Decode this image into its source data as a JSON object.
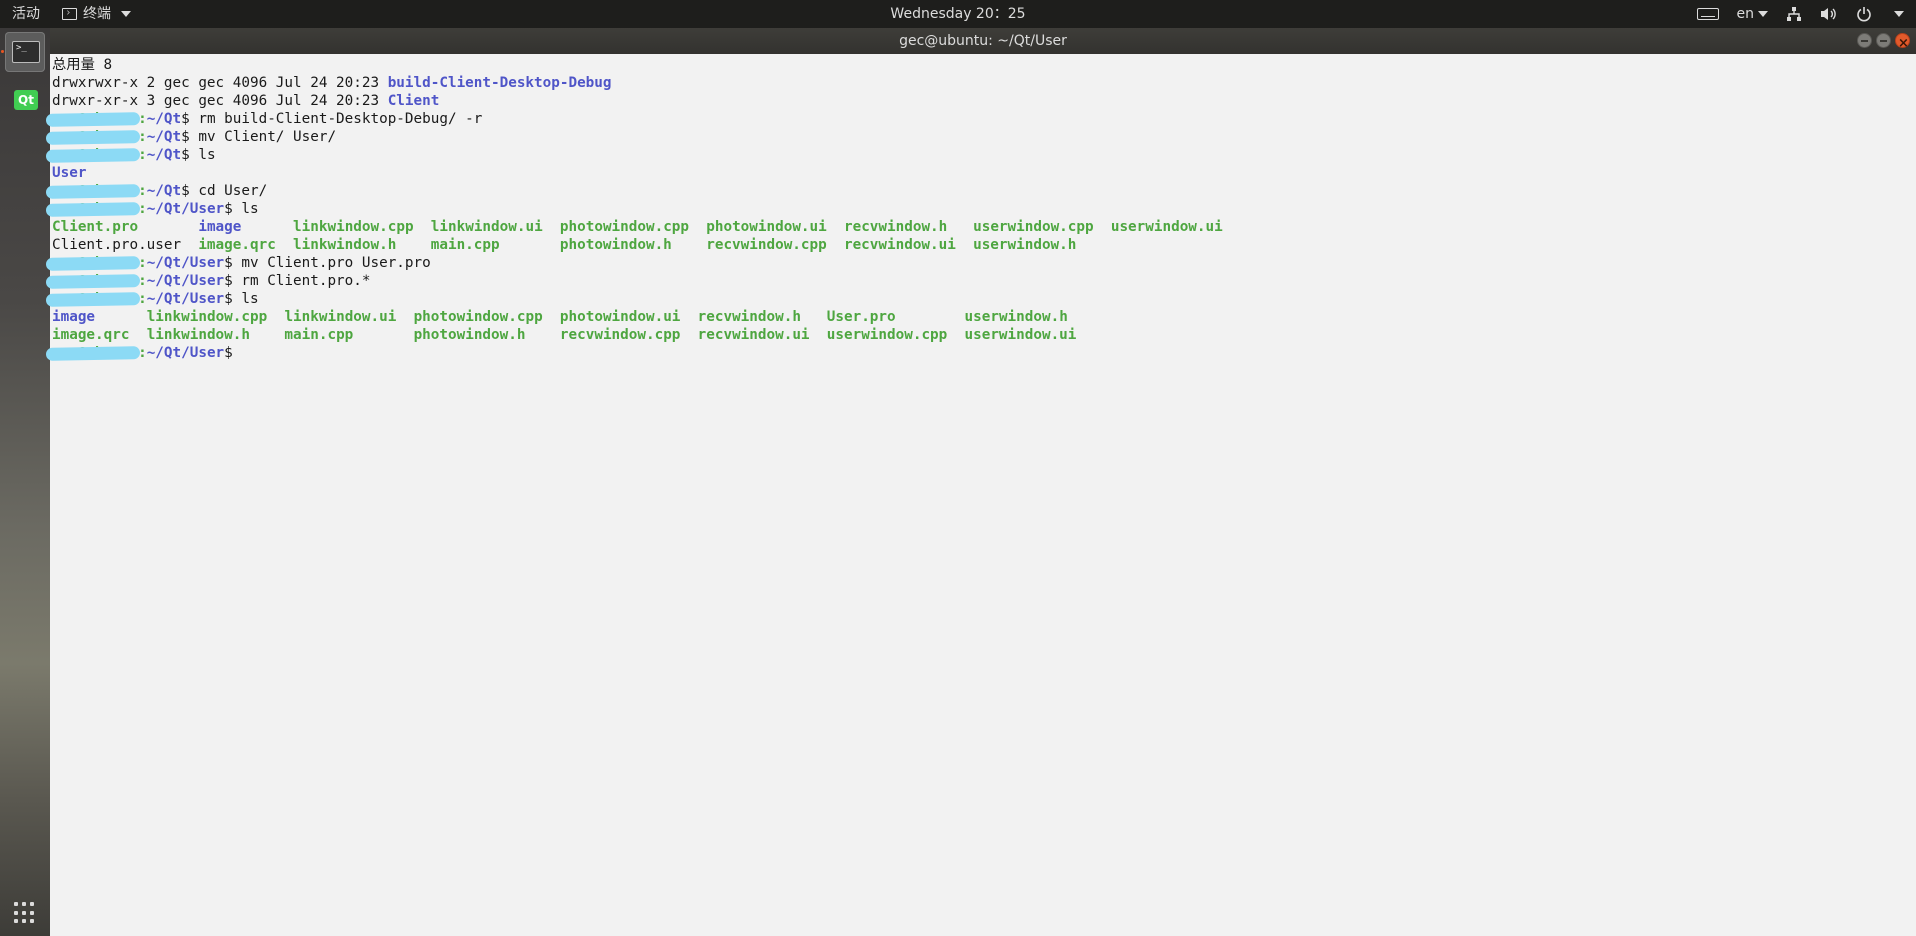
{
  "topbar": {
    "activities": "活动",
    "app_menu": "终端",
    "clock": "Wednesday 20：25",
    "language": "en",
    "icons": [
      "keyboard-icon",
      "network-icon",
      "volume-icon",
      "power-icon"
    ]
  },
  "window": {
    "title": "gec@ubuntu: ~/Qt/User"
  },
  "dock": {
    "apps": [
      "Terminal",
      "Qt Creator"
    ],
    "qt_label": "Qt"
  },
  "terminal": {
    "lines": [
      [
        {
          "t": "总用量 8"
        }
      ],
      [
        {
          "t": "drwxrwxr-x 2 gec gec 4096 Jul 24 20:23 "
        },
        {
          "t": "build-Client-Desktop-Debug",
          "c": "dir"
        }
      ],
      [
        {
          "t": "drwxr-xr-x 3 gec gec 4096 Jul 24 20:23 "
        },
        {
          "t": "Client",
          "c": "dir"
        }
      ],
      [
        {
          "t": "gec@ubuntu",
          "c": "prompt"
        },
        {
          "t": ":",
          "c": "prompt"
        },
        {
          "t": "~/Qt",
          "c": "path"
        },
        {
          "t": "$ rm build-Client-Desktop-Debug/ -r"
        }
      ],
      [
        {
          "t": "gec@ubuntu",
          "c": "prompt"
        },
        {
          "t": ":",
          "c": "prompt"
        },
        {
          "t": "~/Qt",
          "c": "path"
        },
        {
          "t": "$ mv Client/ User/"
        }
      ],
      [
        {
          "t": "gec@ubuntu",
          "c": "prompt"
        },
        {
          "t": ":",
          "c": "prompt"
        },
        {
          "t": "~/Qt",
          "c": "path"
        },
        {
          "t": "$ ls"
        }
      ],
      [
        {
          "t": "User",
          "c": "dir"
        }
      ],
      [
        {
          "t": "gec@ubuntu",
          "c": "prompt"
        },
        {
          "t": ":",
          "c": "prompt"
        },
        {
          "t": "~/Qt",
          "c": "path"
        },
        {
          "t": "$ cd User/"
        }
      ],
      [
        {
          "t": "gec@ubuntu",
          "c": "prompt"
        },
        {
          "t": ":",
          "c": "prompt"
        },
        {
          "t": "~/Qt/User",
          "c": "path"
        },
        {
          "t": "$ ls"
        }
      ],
      [
        {
          "t": "Client.pro",
          "c": "exe"
        },
        {
          "t": "       "
        },
        {
          "t": "image",
          "c": "dir"
        },
        {
          "t": "      "
        },
        {
          "t": "linkwindow.cpp",
          "c": "exe"
        },
        {
          "t": "  "
        },
        {
          "t": "linkwindow.ui",
          "c": "exe"
        },
        {
          "t": "  "
        },
        {
          "t": "photowindow.cpp",
          "c": "exe"
        },
        {
          "t": "  "
        },
        {
          "t": "photowindow.ui",
          "c": "exe"
        },
        {
          "t": "  "
        },
        {
          "t": "recvwindow.h",
          "c": "exe"
        },
        {
          "t": "   "
        },
        {
          "t": "userwindow.cpp",
          "c": "exe"
        },
        {
          "t": "  "
        },
        {
          "t": "userwindow.ui",
          "c": "exe"
        }
      ],
      [
        {
          "t": "Client.pro.user  "
        },
        {
          "t": "image.qrc",
          "c": "exe"
        },
        {
          "t": "  "
        },
        {
          "t": "linkwindow.h",
          "c": "exe"
        },
        {
          "t": "    "
        },
        {
          "t": "main.cpp",
          "c": "exe"
        },
        {
          "t": "       "
        },
        {
          "t": "photowindow.h",
          "c": "exe"
        },
        {
          "t": "    "
        },
        {
          "t": "recvwindow.cpp",
          "c": "exe"
        },
        {
          "t": "  "
        },
        {
          "t": "recvwindow.ui",
          "c": "exe"
        },
        {
          "t": "  "
        },
        {
          "t": "userwindow.h",
          "c": "exe"
        }
      ],
      [
        {
          "t": "gec@ubuntu",
          "c": "prompt"
        },
        {
          "t": ":",
          "c": "prompt"
        },
        {
          "t": "~/Qt/User",
          "c": "path"
        },
        {
          "t": "$ mv Client.pro User.pro"
        }
      ],
      [
        {
          "t": "gec@ubuntu",
          "c": "prompt"
        },
        {
          "t": ":",
          "c": "prompt"
        },
        {
          "t": "~/Qt/User",
          "c": "path"
        },
        {
          "t": "$ rm Client.pro.*"
        }
      ],
      [
        {
          "t": "gec@ubuntu",
          "c": "prompt"
        },
        {
          "t": ":",
          "c": "prompt"
        },
        {
          "t": "~/Qt/User",
          "c": "path"
        },
        {
          "t": "$ ls"
        }
      ],
      [
        {
          "t": "image",
          "c": "dir"
        },
        {
          "t": "      "
        },
        {
          "t": "linkwindow.cpp",
          "c": "exe"
        },
        {
          "t": "  "
        },
        {
          "t": "linkwindow.ui",
          "c": "exe"
        },
        {
          "t": "  "
        },
        {
          "t": "photowindow.cpp",
          "c": "exe"
        },
        {
          "t": "  "
        },
        {
          "t": "photowindow.ui",
          "c": "exe"
        },
        {
          "t": "  "
        },
        {
          "t": "recvwindow.h",
          "c": "exe"
        },
        {
          "t": "   "
        },
        {
          "t": "User.pro",
          "c": "exe"
        },
        {
          "t": "        "
        },
        {
          "t": "userwindow.h",
          "c": "exe"
        }
      ],
      [
        {
          "t": "image.qrc",
          "c": "exe"
        },
        {
          "t": "  "
        },
        {
          "t": "linkwindow.h",
          "c": "exe"
        },
        {
          "t": "    "
        },
        {
          "t": "main.cpp",
          "c": "exe"
        },
        {
          "t": "       "
        },
        {
          "t": "photowindow.h",
          "c": "exe"
        },
        {
          "t": "    "
        },
        {
          "t": "recvwindow.cpp",
          "c": "exe"
        },
        {
          "t": "  "
        },
        {
          "t": "recvwindow.ui",
          "c": "exe"
        },
        {
          "t": "  "
        },
        {
          "t": "userwindow.cpp",
          "c": "exe"
        },
        {
          "t": "  "
        },
        {
          "t": "userwindow.ui",
          "c": "exe"
        }
      ],
      [
        {
          "t": "gec@ubuntu",
          "c": "prompt"
        },
        {
          "t": ":",
          "c": "prompt"
        },
        {
          "t": "~/Qt/User",
          "c": "path"
        },
        {
          "t": "$ "
        }
      ]
    ]
  },
  "colors": {
    "directory": "#4f55c8",
    "executable": "#4ea640",
    "redaction": "#8cdaf5",
    "terminal_bg": "#f2f2f2",
    "panel_bg": "#1e1e1c"
  }
}
